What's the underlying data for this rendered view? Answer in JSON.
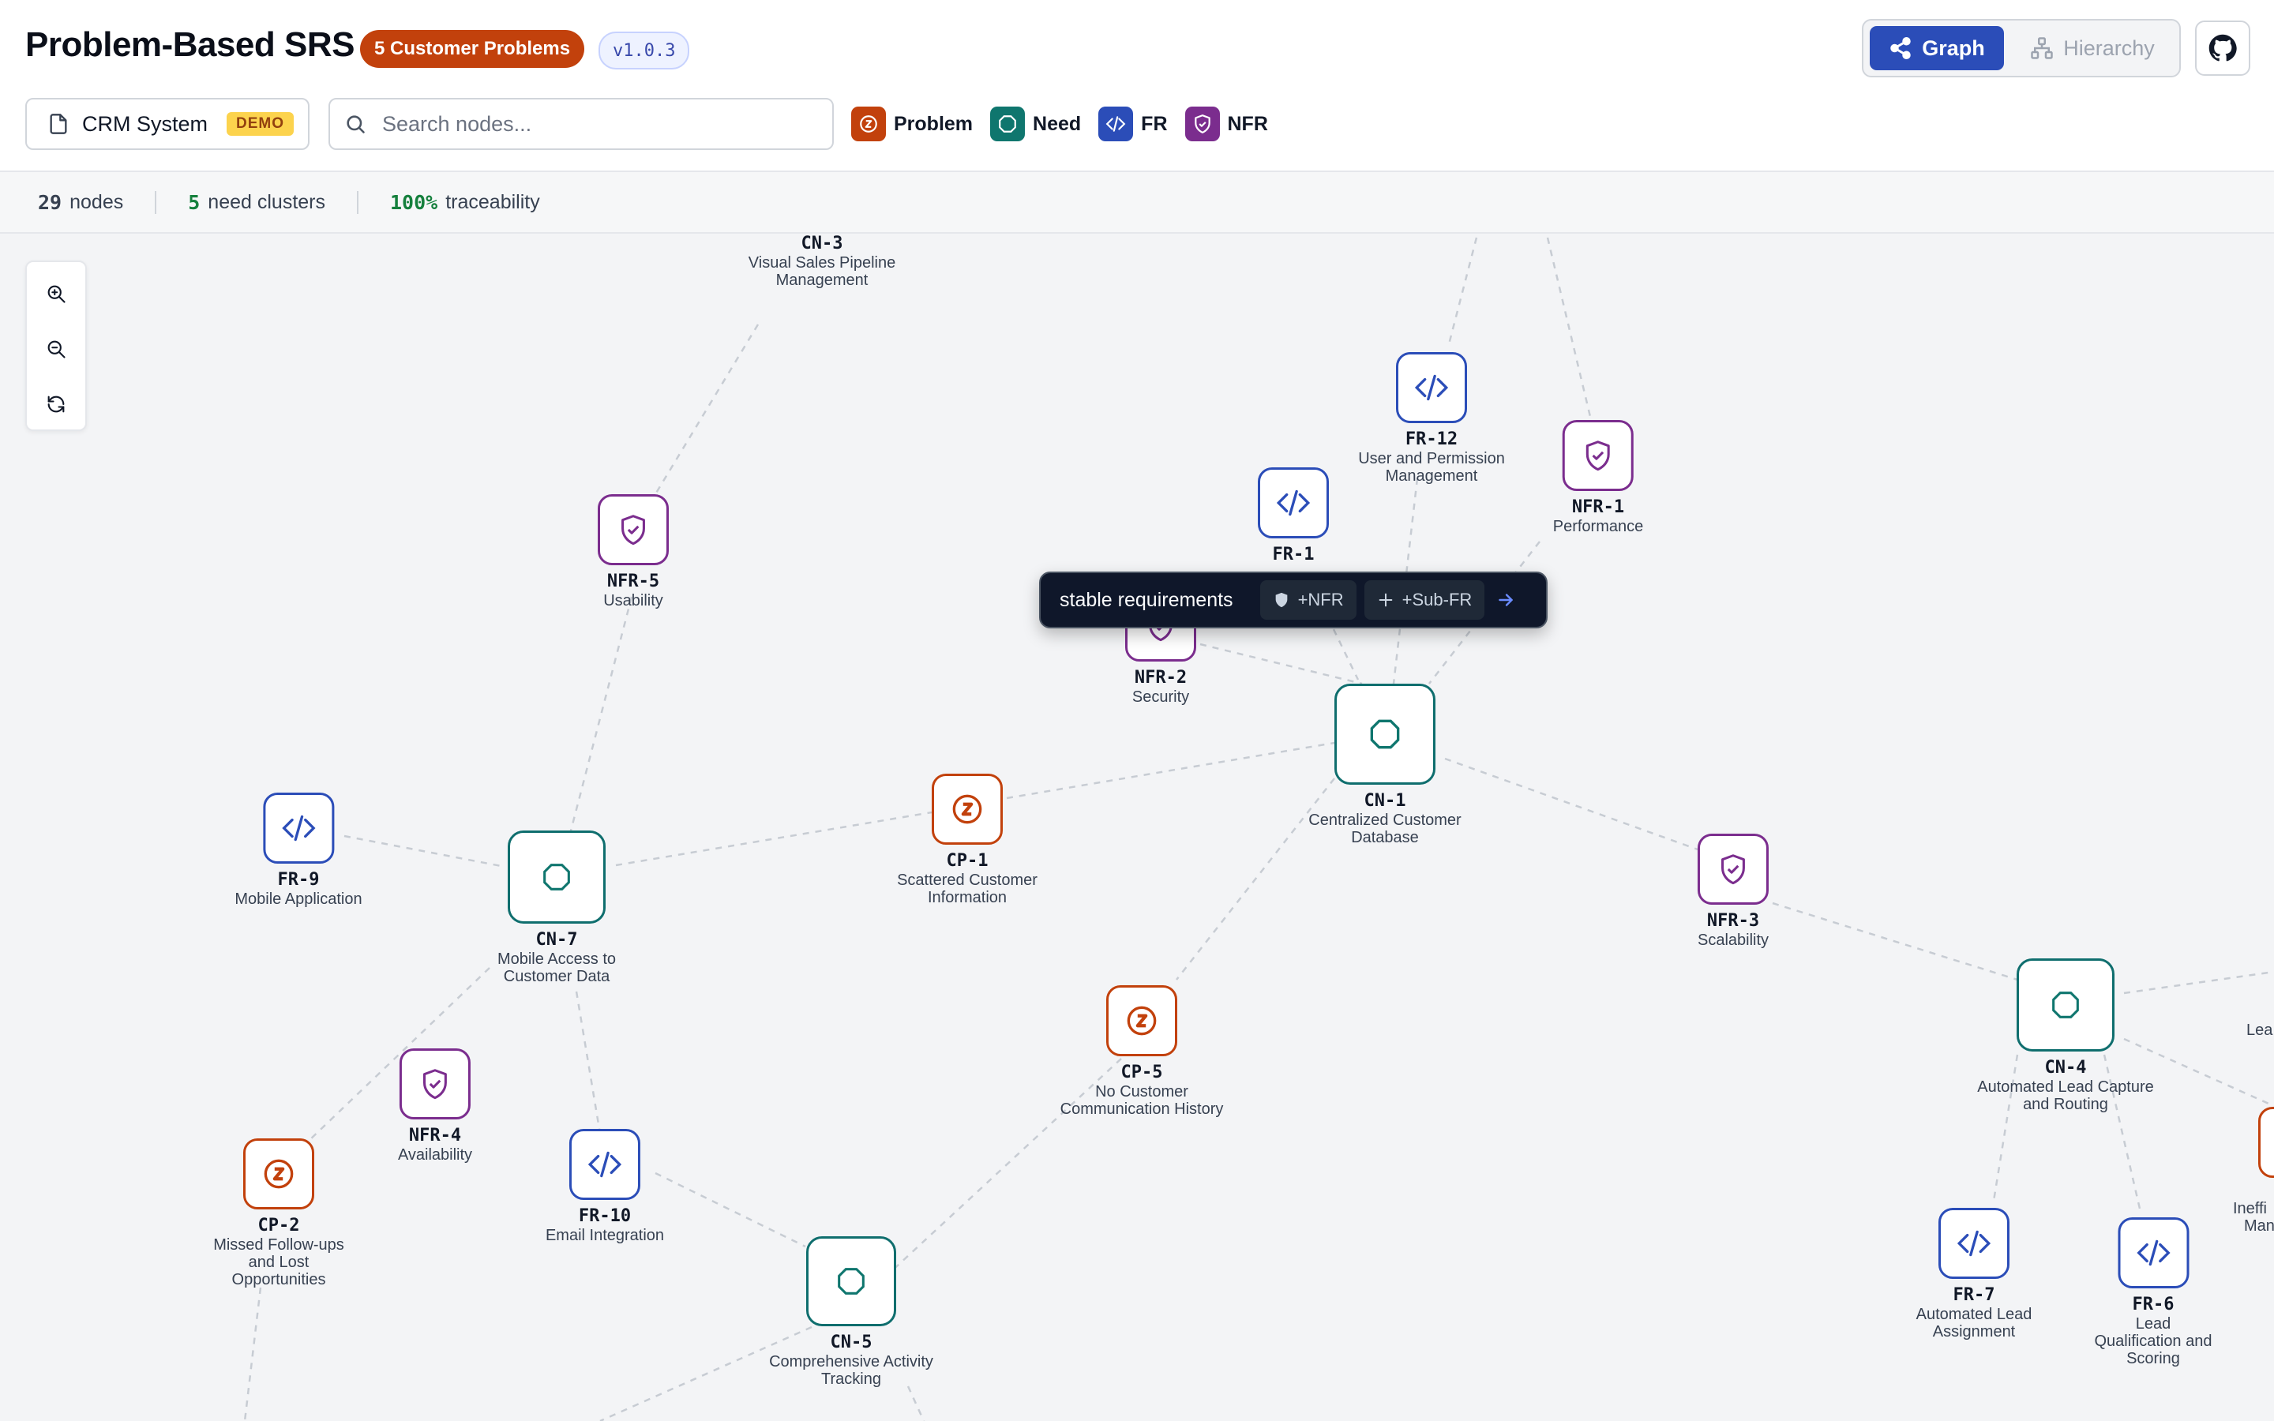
{
  "app": {
    "title": "Problem-Based SRS",
    "problems_badge": "5 Customer Problems",
    "version": "v1.0.3"
  },
  "view_toggle": {
    "graph": "Graph",
    "hierarchy": "Hierarchy",
    "active": "Graph"
  },
  "project": {
    "name": "CRM System",
    "badge": "DEMO"
  },
  "search": {
    "placeholder": "Search nodes...",
    "value": ""
  },
  "legend": [
    {
      "label": "Problem",
      "color": "#c2410c",
      "icon": "problem-icon"
    },
    {
      "label": "Need",
      "color": "#0f766e",
      "icon": "need-icon"
    },
    {
      "label": "FR",
      "color": "#2b4db8",
      "icon": "code-icon"
    },
    {
      "label": "NFR",
      "color": "#7b2d8e",
      "icon": "shield-icon"
    }
  ],
  "stats": {
    "nodes_value": "29",
    "nodes_label": "nodes",
    "clusters_value": "5",
    "clusters_label": "need clusters",
    "trace_value": "100%",
    "trace_label": "traceability"
  },
  "tooltip": {
    "text": "stable requirements",
    "add_nfr": "+NFR",
    "add_subfr": "+Sub-FR"
  },
  "nodes": {
    "cn3": {
      "id": "CN-3",
      "label": "Visual Sales Pipeline Management",
      "type": "need"
    },
    "fr12": {
      "id": "FR-12",
      "label": "User and Permission Management",
      "type": "fr"
    },
    "nfr1": {
      "id": "NFR-1",
      "label": "Performance",
      "type": "nfr"
    },
    "fr1": {
      "id": "FR-1",
      "label": "",
      "type": "fr"
    },
    "nfr5": {
      "id": "NFR-5",
      "label": "Usability",
      "type": "nfr"
    },
    "nfr2": {
      "id": "NFR-2",
      "label": "Security",
      "type": "nfr"
    },
    "cn1": {
      "id": "CN-1",
      "label": "Centralized Customer Database",
      "type": "need"
    },
    "cp1": {
      "id": "CP-1",
      "label": "Scattered Customer Information",
      "type": "problem"
    },
    "fr9": {
      "id": "FR-9",
      "label": "Mobile Application",
      "type": "fr"
    },
    "cn7": {
      "id": "CN-7",
      "label": "Mobile Access to Customer Data",
      "type": "need"
    },
    "nfr3": {
      "id": "NFR-3",
      "label": "Scalability",
      "type": "nfr"
    },
    "cp5": {
      "id": "CP-5",
      "label": "No Customer Communication History",
      "type": "problem"
    },
    "cn4": {
      "id": "CN-4",
      "label": "Automated Lead Capture and Routing",
      "type": "need"
    },
    "nfr4": {
      "id": "NFR-4",
      "label": "Availability",
      "type": "nfr"
    },
    "fr10": {
      "id": "FR-10",
      "label": "Email Integration",
      "type": "fr"
    },
    "cp2": {
      "id": "CP-2",
      "label": "Missed Follow-ups and Lost Opportunities",
      "type": "problem"
    },
    "cn5": {
      "id": "CN-5",
      "label": "Comprehensive Activity Tracking",
      "type": "need"
    },
    "fr7": {
      "id": "FR-7",
      "label": "Automated Lead Assignment",
      "type": "fr"
    },
    "fr6": {
      "id": "FR-6",
      "label": "Lead Qualification and Scoring",
      "type": "fr"
    }
  },
  "edge_fragments": {
    "lea": "Lea",
    "ineffi": "Ineffi",
    "man": "Man"
  }
}
